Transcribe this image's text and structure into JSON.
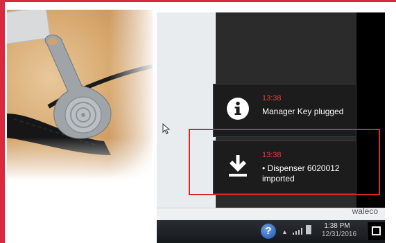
{
  "notifications": [
    {
      "time": "13:38",
      "message": "Manager Key plugged",
      "icon": "info-icon"
    },
    {
      "time": "13:38",
      "message": "• Dispenser 6020012 imported",
      "icon": "download-icon"
    }
  ],
  "brand_text": "waleco",
  "taskbar": {
    "help_label": "?",
    "tray_arrow": "▲",
    "time": "1:38 PM",
    "date": "12/31/2016"
  },
  "colors": {
    "accent": "#d9293f",
    "notification_time": "#e0423a",
    "highlight_box": "#d42a2a"
  }
}
